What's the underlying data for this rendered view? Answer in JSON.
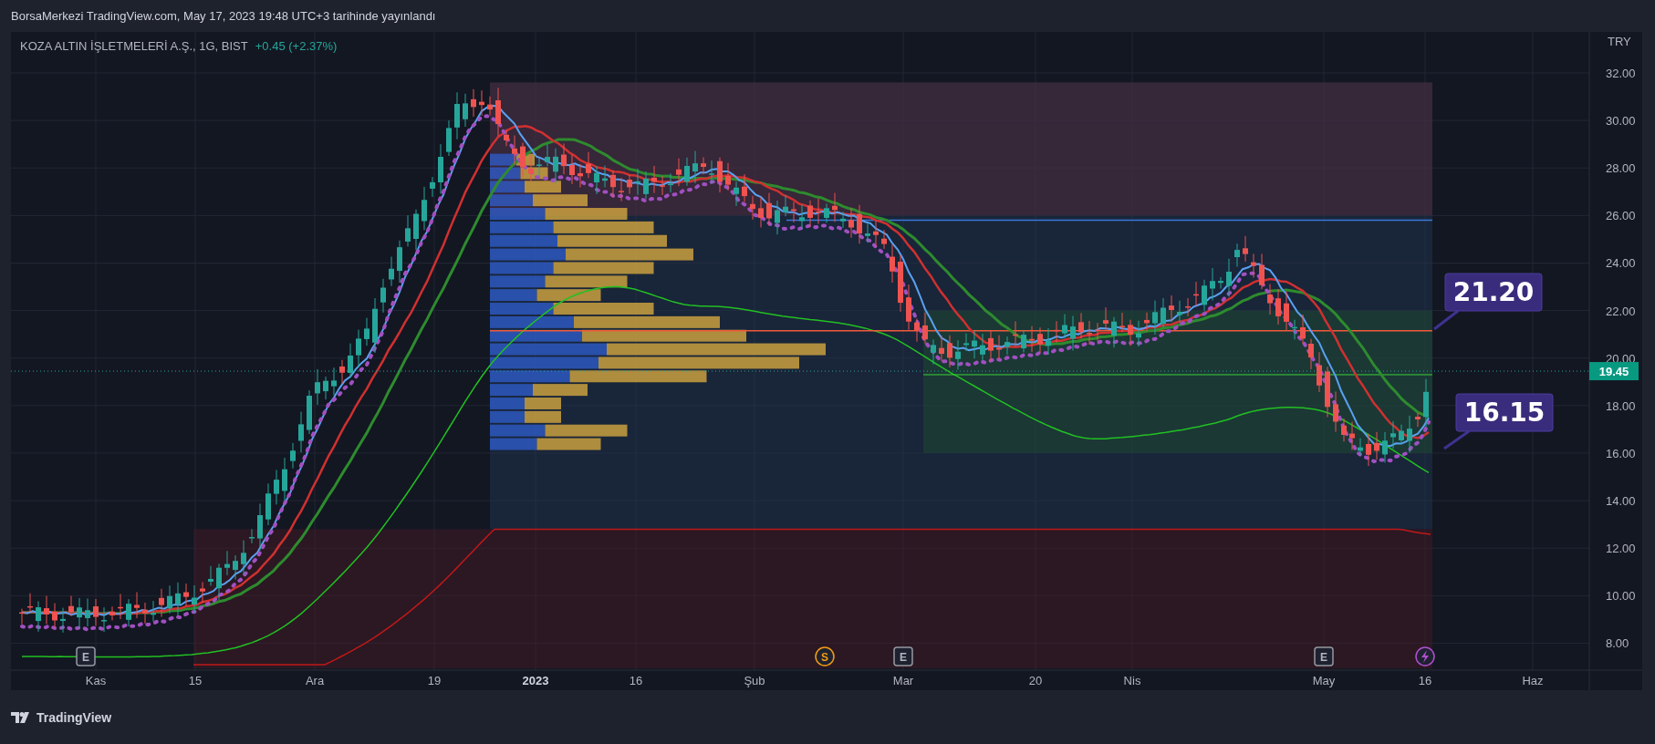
{
  "header": {
    "text": "BorsaMerkezi TradingView.com, May 17, 2023 19:48 UTC+3 tarihinde yayınlandı"
  },
  "symbol": {
    "name": "KOZA ALTIN İŞLETMELERİ A.Ş., 1G, BIST",
    "change": "+0.45 (+2.37%)"
  },
  "price_axis": {
    "currency": "TRY",
    "ticks": [
      "32.00",
      "30.00",
      "28.00",
      "26.00",
      "24.00",
      "22.00",
      "20.00",
      "18.00",
      "16.00",
      "14.00",
      "12.00",
      "10.00",
      "8.00"
    ],
    "last_price": "19.45"
  },
  "time_axis": [
    {
      "label": "Kas",
      "bold": false
    },
    {
      "label": "15",
      "bold": false
    },
    {
      "label": "Ara",
      "bold": false
    },
    {
      "label": "19",
      "bold": false
    },
    {
      "label": "2023",
      "bold": true
    },
    {
      "label": "16",
      "bold": false
    },
    {
      "label": "Şub",
      "bold": false
    },
    {
      "label": "Mar",
      "bold": false
    },
    {
      "label": "20",
      "bold": false
    },
    {
      "label": "Nis",
      "bold": false
    },
    {
      "label": "May",
      "bold": false
    },
    {
      "label": "16",
      "bold": false
    },
    {
      "label": "Haz",
      "bold": false
    }
  ],
  "callouts": [
    "21.20",
    "16.15"
  ],
  "events": [
    {
      "kind": "earnings",
      "label": "E"
    },
    {
      "kind": "dividend",
      "label": "S"
    },
    {
      "kind": "earnings",
      "label": "E"
    },
    {
      "kind": "earnings",
      "label": "E"
    },
    {
      "kind": "news"
    }
  ],
  "footer": {
    "brand": "TradingView"
  }
}
